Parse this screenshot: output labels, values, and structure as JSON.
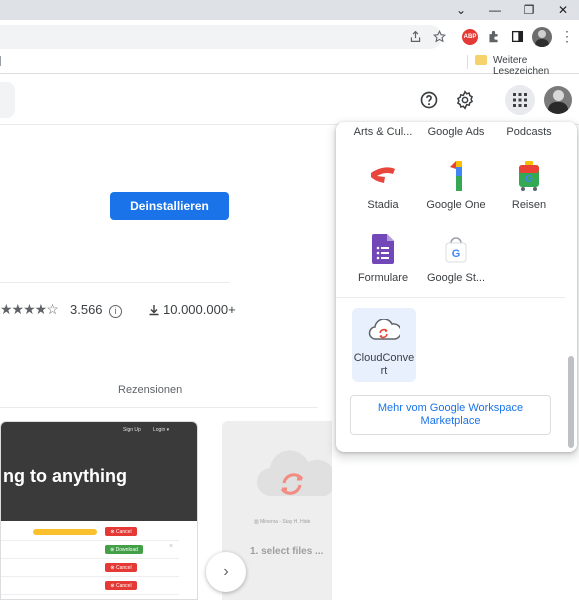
{
  "browser": {
    "window_controls": {
      "menu": "⌄",
      "minimize": "—",
      "restore": "❐",
      "close": "✕"
    },
    "bookmarks_bar": {
      "other_bookmarks": "Weitere Lesezeichen"
    },
    "extensions": {
      "abp_badge": "ABP"
    },
    "icons": [
      "share-icon",
      "star-icon",
      "puzzle-icon",
      "sidepanel-icon",
      "kebab-menu-icon"
    ]
  },
  "header": {
    "icons": [
      "help-icon",
      "settings-icon",
      "apps-grid-icon",
      "avatar"
    ]
  },
  "listing": {
    "uninstall_label": "Deinstallieren",
    "stars": "★★★★☆",
    "rating_count": "3.566",
    "downloads": "10.000.000+",
    "tabs": {
      "reviews": "Rezensionen"
    }
  },
  "screenshots": {
    "card1": {
      "nav_signup": "Sign Up",
      "nav_login": "Login ▾",
      "hero": "ng to anything",
      "buttons": [
        "⊗ Cancel",
        "⊗ Download",
        "⊗ Cancel",
        "⊗ Cancel"
      ]
    },
    "card2": {
      "subtitle": "▥ Minerva - Stay H. Hide",
      "step": "1. select files ..."
    },
    "next_icon": "›"
  },
  "apps_popup": {
    "top_row": [
      "Arts & Cul...",
      "Google Ads",
      "Podcasts"
    ],
    "row2": [
      "Stadia",
      "Google One",
      "Reisen"
    ],
    "row3": [
      "Formulare",
      "Google St..."
    ],
    "installed_app": "CloudConvert",
    "marketplace_button": "Mehr vom Google Workspace Marketplace"
  },
  "colors": {
    "primary_blue": "#1a73e8",
    "chrome_gray": "#dee1e6",
    "cancel_red": "#e53935",
    "download_green": "#43a047"
  }
}
